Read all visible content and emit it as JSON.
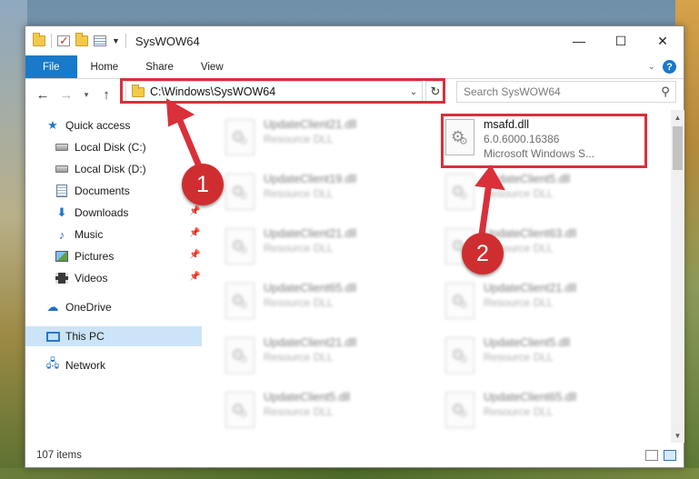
{
  "window": {
    "title": "SysWOW64"
  },
  "ribbon": {
    "tabs": [
      "File",
      "Home",
      "Share",
      "View"
    ]
  },
  "navigation": {
    "address": "C:\\Windows\\SysWOW64",
    "search_placeholder": "Search SysWOW64"
  },
  "sidebar": {
    "items": [
      {
        "label": "Quick access",
        "icon": "star-icon"
      },
      {
        "label": "Local Disk (C:)",
        "icon": "drive-icon"
      },
      {
        "label": "Local Disk (D:)",
        "icon": "drive-icon"
      },
      {
        "label": "Documents",
        "icon": "documents-icon",
        "pinned": true
      },
      {
        "label": "Downloads",
        "icon": "download-icon",
        "pinned": true
      },
      {
        "label": "Music",
        "icon": "music-icon",
        "pinned": true
      },
      {
        "label": "Pictures",
        "icon": "pictures-icon",
        "pinned": true
      },
      {
        "label": "Videos",
        "icon": "videos-icon",
        "pinned": true
      },
      {
        "label": "OneDrive",
        "icon": "cloud-icon"
      },
      {
        "label": "This PC",
        "icon": "computer-icon",
        "selected": true
      },
      {
        "label": "Network",
        "icon": "network-icon"
      }
    ]
  },
  "files": [
    {
      "name": "UpdateClient21.dll",
      "sub": "Resource DLL",
      "blurred": true
    },
    {
      "name": "msafd.dll",
      "version": "6.0.6000.16386",
      "company": "Microsoft Windows S...",
      "blurred": false
    },
    {
      "name": "UpdateClient19.dll",
      "sub": "Resource DLL",
      "blurred": true
    },
    {
      "name": "UpdateClient5.dll",
      "sub": "Resource DLL",
      "blurred": true
    },
    {
      "name": "UpdateClient21.dll",
      "sub": "Resource DLL",
      "blurred": true
    },
    {
      "name": "UpdateClient63.dll",
      "sub": "Resource DLL",
      "blurred": true
    },
    {
      "name": "UpdateClient65.dll",
      "sub": "Resource DLL",
      "blurred": true
    },
    {
      "name": "UpdateClient21.dll",
      "sub": "Resource DLL",
      "blurred": true
    },
    {
      "name": "UpdateClient21.dll",
      "sub": "Resource DLL",
      "blurred": true
    },
    {
      "name": "UpdateClient5.dll",
      "sub": "Resource DLL",
      "blurred": true
    },
    {
      "name": "UpdateClient5.dll",
      "sub": "Resource DLL",
      "blurred": true
    },
    {
      "name": "UpdateClient65.dll",
      "sub": "Resource DLL",
      "blurred": true
    }
  ],
  "status": {
    "item_count": "107 items"
  },
  "annotations": {
    "badge_1": "1",
    "badge_2": "2",
    "color": "#d9303a"
  }
}
